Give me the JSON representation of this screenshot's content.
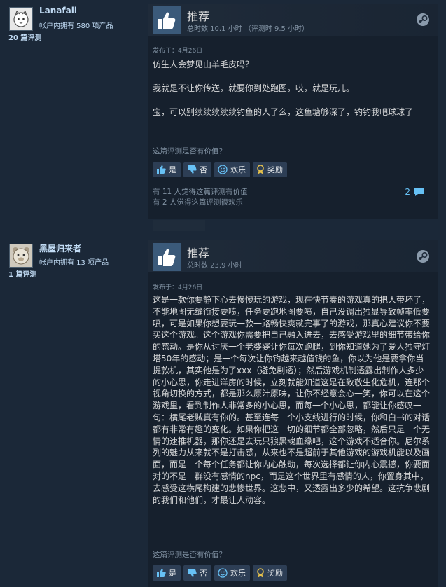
{
  "reviews": [
    {
      "author": {
        "name": "Lanafall",
        "games_owned": "帐户内拥有 580 项产品",
        "review_count": "20 篇评测"
      },
      "vote": {
        "label": "推荐",
        "hours": "总时数 10.1 小时 （评测时 9.5 小时）",
        "icon": "thumbs-up-icon"
      },
      "posted": "发布于：4月26日",
      "text": "仿生人会梦见山羊毛皮吗？\n\n我就是不让你传送，就要你到处跑图，哎，就是玩儿。\n\n宝，可以别续续续续续钓鱼的人了么，这鱼塘够深了，钓钓我吧球球了",
      "helpful_question": "这篇评测是否有价值？",
      "buttons": {
        "yes": "是",
        "no": "否",
        "funny": "欢乐",
        "award": "奖励"
      },
      "stats": {
        "helpful": "有 11 人觉得这篇评测有价值",
        "funny": "有 2 人觉得这篇评测很欢乐"
      },
      "comment_count": "2"
    },
    {
      "author": {
        "name": "黑屋归来者",
        "games_owned": "帐户内拥有 13 项产品",
        "review_count": "1 篇评测"
      },
      "vote": {
        "label": "推荐",
        "hours": "总时数 23.9 小时",
        "icon": "thumbs-up-icon"
      },
      "posted": "发布于：4月26日",
      "text": "这是一款你要静下心去慢慢玩的游戏，现在快节奏的游戏真的把人带坏了，不能地图无缝衔接要喷，任务要跑地图要喷，自己没调出独显导致帧率低要喷，可是如果你想要玩一款一路畅快爽就完事了的游戏，那真心建议你不要买这个游戏。这个游戏你需要把自己融入进去，去感受游戏里的细节带给你的感动。是你从讨厌一个老婆婆让你每次跑腿，到你知道她为了爱人独守灯塔50年的感动；是一个每次让你钓越来越值钱的鱼，你以为他是要拿你当提款机，其实他是为了xxx（避免剧透）；然后游戏机制透露出制作人多少的小心思，你走进洋房的时候，立刻就能知道这是在致敬生化危机，连那个视角切换的方式，都是那么原汁原味，让你不经意会心一笑，你可以在这个游戏里，看到制作人非常多的小心思，而每一个小心思，都能让你感叹一句：横尾老贼真有你的。甚至连每一个小支线进行的时候，你和白书的对话都有非常有趣的变化。如果你把这一切的细节都全部忽略，然后只是一个无情的速推机器，那你还是去玩只狼黑魂血缘吧，这个游戏不适合你。尼尔系列的魅力从来就不是打击感，从来也不是超前于其他游戏的游戏机能以及画面，而是一个每个任务都让你内心触动，每次选择都让你内心震撼，你要面对的不是一群没有感情的npc，而是这个世界里有感情的人，你置身其中，去感受这横尾构建的悲惨世界。这悲中，又透露出多少的希望。这抗争悲剧的我们和他们，才最让人动容。",
      "helpful_question": "这篇评测是否有价值？",
      "buttons": {
        "yes": "是",
        "no": "否",
        "funny": "欢乐",
        "award": "奖励"
      }
    }
  ],
  "colors": {
    "background": "#1b2838",
    "panel": "#16202d",
    "accent": "#66c0f4",
    "button": "#2d3e55"
  }
}
